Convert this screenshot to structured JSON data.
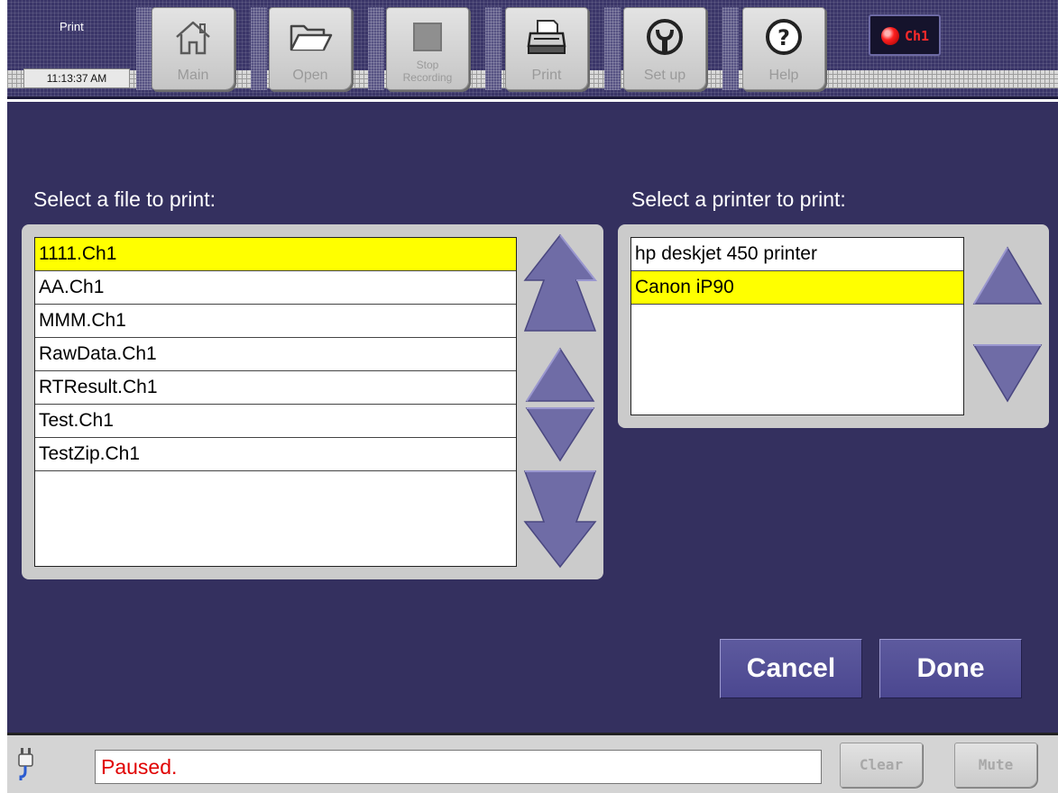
{
  "header": {
    "screen_title": "Print",
    "clock": "11:13:37 AM",
    "buttons": [
      {
        "id": "main",
        "label": "Main",
        "icon": "home-icon"
      },
      {
        "id": "open",
        "label": "Open",
        "icon": "folder-icon"
      },
      {
        "id": "stop",
        "label_line1": "Stop",
        "label_line2": "Recording",
        "icon": "stop-icon"
      },
      {
        "id": "print",
        "label": "Print",
        "icon": "printer-icon"
      },
      {
        "id": "setup",
        "label": "Set up",
        "icon": "wrench-icon"
      },
      {
        "id": "help",
        "label": "Help",
        "icon": "help-icon"
      }
    ],
    "channel_indicator": "Ch1"
  },
  "file_section": {
    "title": "Select a file to print:",
    "items": [
      "1111.Ch1",
      "AA.Ch1",
      "MMM.Ch1",
      "RawData.Ch1",
      "RTResult.Ch1",
      "Test.Ch1",
      "TestZip.Ch1"
    ],
    "selected_index": 0
  },
  "printer_section": {
    "title": "Select a printer to print:",
    "items": [
      "hp deskjet 450 printer",
      "Canon iP90"
    ],
    "selected_index": 1
  },
  "actions": {
    "cancel_label": "Cancel",
    "done_label": "Done"
  },
  "status_bar": {
    "message": "Paused.",
    "clear_label": "Clear",
    "mute_label": "Mute"
  },
  "colors": {
    "background": "#34305f",
    "selection": "#ffff00",
    "arrow": "#6f6ca6",
    "status_text": "#e00000"
  }
}
